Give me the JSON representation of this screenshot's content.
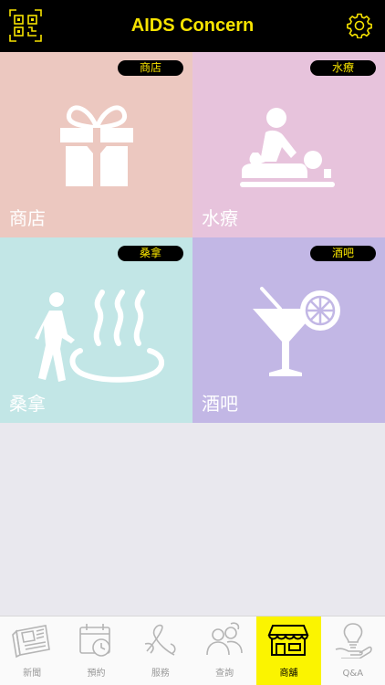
{
  "header": {
    "title": "AIDS Concern"
  },
  "tiles": [
    {
      "tag": "商店",
      "label": "商店",
      "icon": "gift-icon",
      "color": "#ecc8c0"
    },
    {
      "tag": "水療",
      "label": "水療",
      "icon": "massage-icon",
      "color": "#e7c3dc"
    },
    {
      "tag": "桑拿",
      "label": "桑拿",
      "icon": "sauna-icon",
      "color": "#c2e6e6"
    },
    {
      "tag": "酒吧",
      "label": "酒吧",
      "icon": "cocktail-icon",
      "color": "#c2b7e5"
    }
  ],
  "tabs": [
    {
      "label": "新聞",
      "icon": "newspaper-icon"
    },
    {
      "label": "預約",
      "icon": "calendar-clock-icon"
    },
    {
      "label": "服務",
      "icon": "ribbon-icon"
    },
    {
      "label": "查詢",
      "icon": "people-chat-icon"
    },
    {
      "label": "商舖",
      "icon": "storefront-icon",
      "active": true
    },
    {
      "label": "Q&A",
      "icon": "lightbulb-hand-icon"
    }
  ],
  "colors": {
    "accent": "#f7e300",
    "header_bg": "#000000"
  }
}
